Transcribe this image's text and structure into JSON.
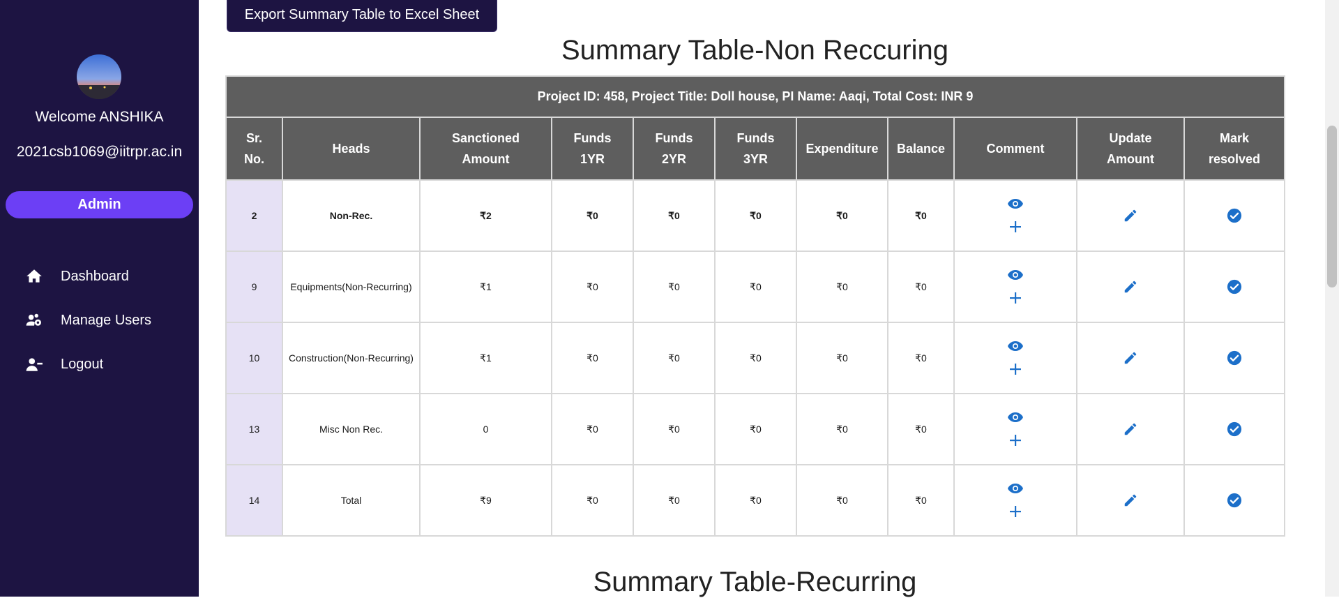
{
  "sidebar": {
    "welcome": "Welcome ANSHIKA",
    "email": "2021csb1069@iitrpr.ac.in",
    "role": "Admin",
    "nav": [
      {
        "label": "Dashboard",
        "icon": "home-icon"
      },
      {
        "label": "Manage Users",
        "icon": "users-gear-icon"
      },
      {
        "label": "Logout",
        "icon": "user-minus-icon"
      }
    ]
  },
  "main": {
    "export_label": "Export Summary Table to Excel Sheet",
    "title_nonrecurring": "Summary Table-Non Reccuring",
    "title_recurring": "Summary Table-Recurring",
    "caption": "Project ID: 458, Project Title: Doll house, PI Name: Aaqi, Total Cost: INR 9",
    "headers": {
      "sr_line1": "Sr.",
      "sr_line2": "No.",
      "heads": "Heads",
      "sanc_line1": "Sanctioned",
      "sanc_line2": "Amount",
      "f1_line1": "Funds",
      "f1_line2": "1YR",
      "f2_line1": "Funds",
      "f2_line2": "2YR",
      "f3_line1": "Funds",
      "f3_line2": "3YR",
      "expenditure": "Expenditure",
      "balance": "Balance",
      "comment": "Comment",
      "upd_line1": "Update",
      "upd_line2": "Amount",
      "mark_line1": "Mark",
      "mark_line2": "resolved"
    },
    "rows": [
      {
        "sr": "2",
        "head": "Non-Rec.",
        "sanctioned": "₹2",
        "f1": "₹0",
        "f2": "₹0",
        "f3": "₹0",
        "exp": "₹0",
        "bal": "₹0"
      },
      {
        "sr": "9",
        "head": "Equipments(Non-Recurring)",
        "sanctioned": "₹1",
        "f1": "₹0",
        "f2": "₹0",
        "f3": "₹0",
        "exp": "₹0",
        "bal": "₹0"
      },
      {
        "sr": "10",
        "head": "Construction(Non-Recurring)",
        "sanctioned": "₹1",
        "f1": "₹0",
        "f2": "₹0",
        "f3": "₹0",
        "exp": "₹0",
        "bal": "₹0"
      },
      {
        "sr": "13",
        "head": "Misc Non Rec.",
        "sanctioned": "0",
        "f1": "₹0",
        "f2": "₹0",
        "f3": "₹0",
        "exp": "₹0",
        "bal": "₹0"
      },
      {
        "sr": "14",
        "head": "Total",
        "sanctioned": "₹9",
        "f1": "₹0",
        "f2": "₹0",
        "f3": "₹0",
        "exp": "₹0",
        "bal": "₹0"
      }
    ]
  },
  "colors": {
    "sidebar": "#1d1442",
    "accent": "#6c3ff5",
    "header": "#5e5e5e",
    "icon": "#1c6fc9",
    "sr_cell": "#e6e1f5"
  }
}
